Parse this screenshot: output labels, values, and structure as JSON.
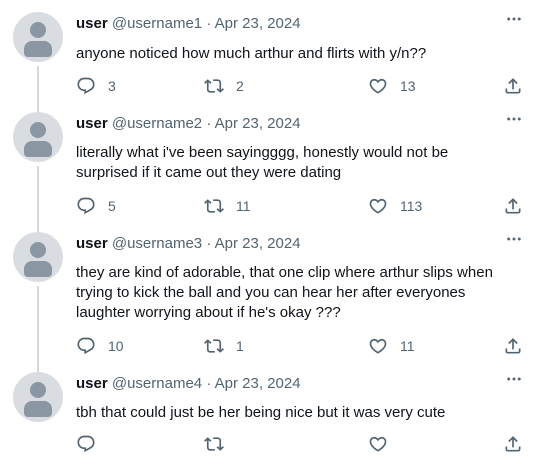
{
  "tweets": [
    {
      "name": "user",
      "handle": "@username1",
      "dot": "·",
      "date": "Apr 23, 2024",
      "text": "anyone noticed how much arthur and flirts with y/n??",
      "replies": "3",
      "retweets": "2",
      "likes": "13"
    },
    {
      "name": "user",
      "handle": "@username2",
      "dot": "·",
      "date": "Apr 23, 2024",
      "text": "literally what i've been sayingggg, honestly would not be surprised if it came out they were dating",
      "replies": "5",
      "retweets": "11",
      "likes": "113"
    },
    {
      "name": "user",
      "handle": "@username3",
      "dot": "·",
      "date": "Apr 23, 2024",
      "text": "they are kind of adorable, that one clip where arthur slips when trying to kick the ball and you can hear her after everyones laughter worrying about if he's okay ???",
      "replies": "10",
      "retweets": "1",
      "likes": "11"
    },
    {
      "name": "user",
      "handle": "@username4",
      "dot": "·",
      "date": "Apr 23, 2024",
      "text": "tbh that could just be her being nice but it was very cute",
      "replies": "",
      "retweets": "",
      "likes": ""
    }
  ],
  "icons": {
    "more": "more-horizontal-icon",
    "reply": "reply-icon",
    "retweet": "retweet-icon",
    "like": "heart-icon",
    "share": "share-icon"
  },
  "colors": {
    "text": "#0f1419",
    "secondary": "#536471",
    "thread_line": "#cfd9de",
    "avatar_bg": "#d9dde1",
    "avatar_fg": "#8a97a3"
  }
}
